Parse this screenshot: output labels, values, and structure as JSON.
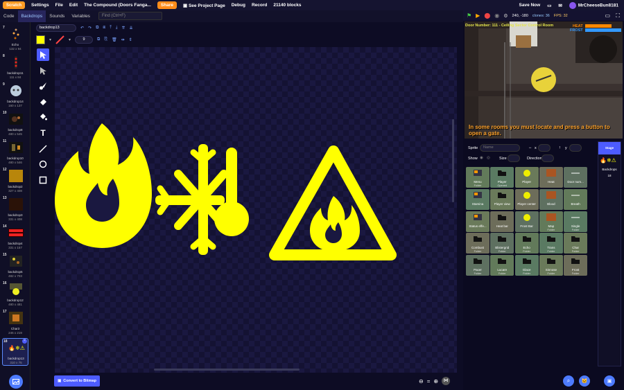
{
  "menubar": {
    "logo": "Scratch",
    "items": [
      "Settings",
      "File",
      "Edit"
    ],
    "project_title": "The Compound (Doors Fanga...",
    "share": "Share",
    "see_project_page": "See Project Page",
    "debug": "Debug",
    "record": "Record",
    "blocks": "21140 blocks",
    "save_now": "Save Now",
    "username": "MrCheeseBun8181"
  },
  "tabs": {
    "code": "Code",
    "backdrops": "Backdrops",
    "sounds": "Sounds",
    "variables": "Variables",
    "find_placeholder": "Find (Ctrl+F)"
  },
  "costumes": [
    {
      "num": "7",
      "name": "Echo",
      "size": "132 x 94"
    },
    {
      "num": "8",
      "name": "backdrop11",
      "size": "111 x 84"
    },
    {
      "num": "9",
      "name": "backdrop14",
      "size": "160 x 137"
    },
    {
      "num": "10",
      "name": "backdrop8",
      "size": "480 x 545"
    },
    {
      "num": "11",
      "name": "backdrop10",
      "size": "480 x 546"
    },
    {
      "num": "12",
      "name": "backdrop2",
      "size": "327 x 408"
    },
    {
      "num": "13",
      "name": "backdrop3",
      "size": "331 x 408"
    },
    {
      "num": "14",
      "name": "backdrop4",
      "size": "331 x 157"
    },
    {
      "num": "15",
      "name": "backdrop5",
      "size": "482 x 703"
    },
    {
      "num": "16",
      "name": "backdrop12",
      "size": "480 x 481"
    },
    {
      "num": "17",
      "name": "Char3",
      "size": "246 x 219"
    },
    {
      "num": "18",
      "name": "backdrop13",
      "size": "310 x 75"
    }
  ],
  "paint": {
    "costume_name": "backdrop13",
    "stroke_width": "9",
    "fill_color": "#ffff00",
    "convert_label": "Convert to Bitmap"
  },
  "stage": {
    "fps": "FPS: 32",
    "clones": "clones: 36",
    "coords": "240, -180",
    "door_text": "Door Number: 111 - Ceiling Sector Control Room",
    "heat": "HEAT",
    "frost": "FROST",
    "hint": "In some rooms you must locate and press a button to open a gate."
  },
  "sprite_info": {
    "sprite_label": "Sprite",
    "name_placeholder": "Name",
    "x_label": "x",
    "y_label": "y",
    "show_label": "Show",
    "size_label": "Size",
    "direction_label": "Direction"
  },
  "sprites": [
    {
      "name": "Menu",
      "folder": "Folder"
    },
    {
      "name": "Player",
      "folder": "Opened"
    },
    {
      "name": "Player",
      "folder": ""
    },
    {
      "name": "Heat",
      "folder": ""
    },
    {
      "name": "Door num...",
      "folder": ""
    },
    {
      "name": "Stamina",
      "folder": ""
    },
    {
      "name": "Player view",
      "folder": ""
    },
    {
      "name": "Player center",
      "folder": ""
    },
    {
      "name": "Blood",
      "folder": ""
    },
    {
      "name": "Breath",
      "folder": ""
    },
    {
      "name": "Status effe...",
      "folder": ""
    },
    {
      "name": "Heat bar",
      "folder": ""
    },
    {
      "name": "Frost Bar",
      "folder": ""
    },
    {
      "name": "Map",
      "folder": "Folder"
    },
    {
      "name": "Single",
      "folder": "Folder"
    },
    {
      "name": "Combust",
      "folder": "Folder"
    },
    {
      "name": "Blistergrid",
      "folder": "Folder"
    },
    {
      "name": "Echo",
      "folder": "Folder"
    },
    {
      "name": "Trans",
      "folder": "Folder"
    },
    {
      "name": "Char",
      "folder": "Folder"
    },
    {
      "name": "Pacer",
      "folder": "Folder"
    },
    {
      "name": "Lucare",
      "folder": "Folder"
    },
    {
      "name": "Glace",
      "folder": "Folder"
    },
    {
      "name": "Sinnose",
      "folder": "Folder"
    },
    {
      "name": "Frost",
      "folder": "Folder"
    }
  ],
  "stage_pane": {
    "tab": "Stage",
    "backdrops_label": "Backdrops",
    "backdrops_count": "18"
  }
}
